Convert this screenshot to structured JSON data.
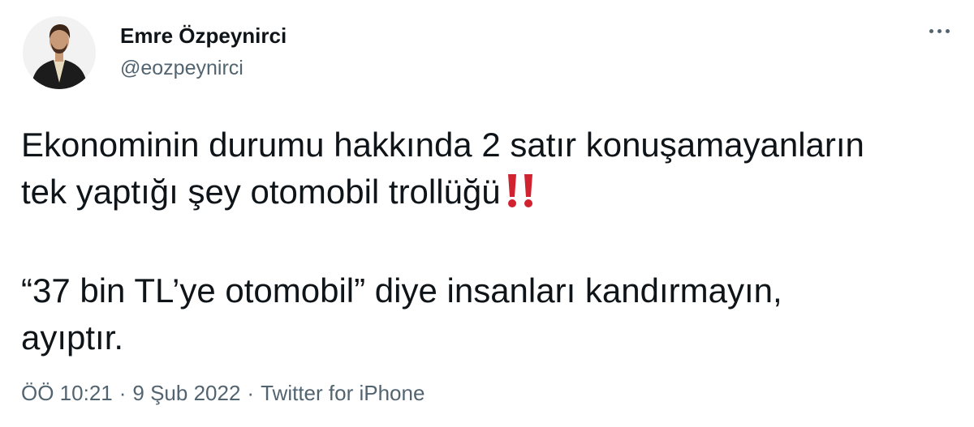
{
  "author": {
    "display_name": "Emre Özpeynirci",
    "handle": "@eozpeynirci",
    "avatar_icon": "profile-photo"
  },
  "more_menu": {
    "icon": "more-horizontal-icon"
  },
  "tweet": {
    "line1": "Ekonominin durumu hakkında 2 satır konuşamayanların",
    "line2": "tek yaptığı şey otomobil trollüğü",
    "emoji": "‼️",
    "line3": "“37 bin TL’ye otomobil” diye insanları kandırmayın,",
    "line4": "ayıptır."
  },
  "meta": {
    "time": "ÖÖ 10:21",
    "sep1": "·",
    "date": "9 Şub 2022",
    "sep2": "·",
    "source": "Twitter for iPhone"
  },
  "colors": {
    "text": "#0f1419",
    "secondary": "#536471",
    "emoji": "#d1232f"
  }
}
